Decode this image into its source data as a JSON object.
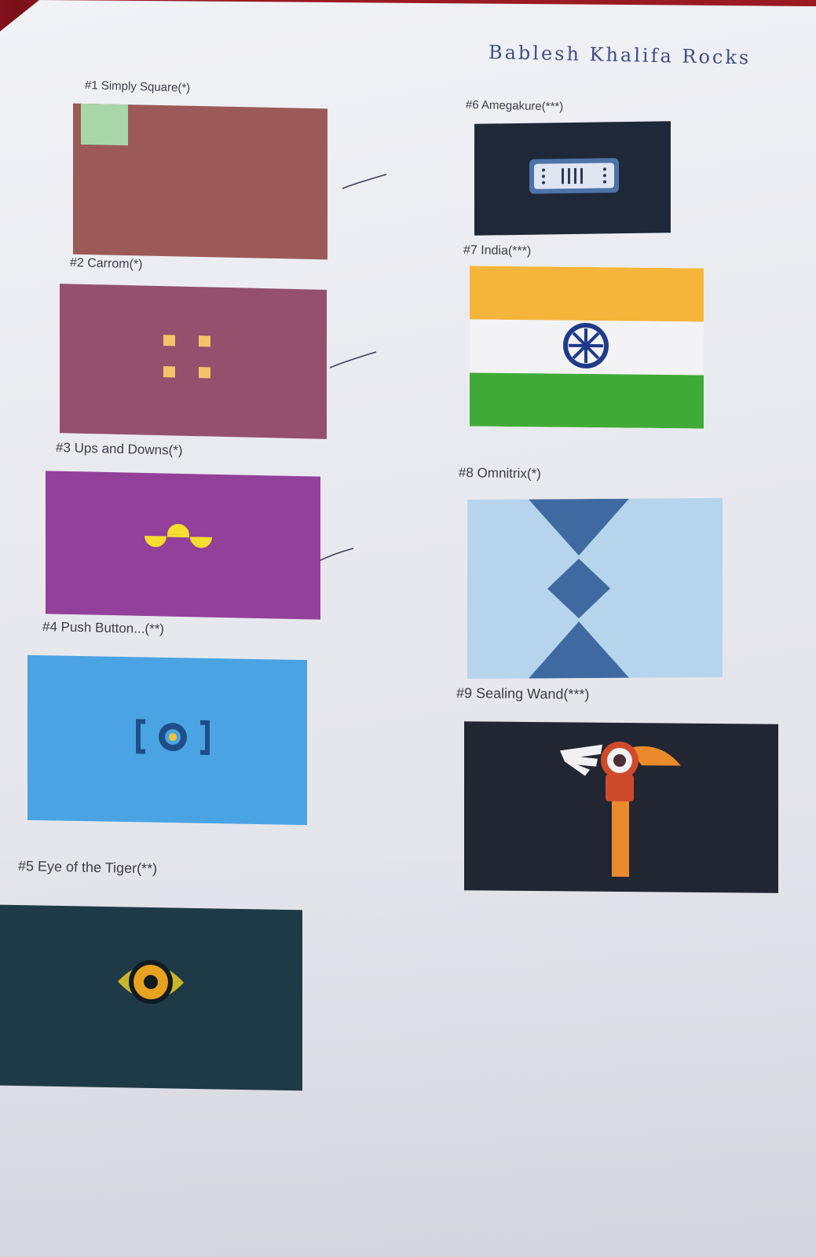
{
  "note": {
    "handwritten_header": "Bablesh Khalifa Rocks"
  },
  "flags": [
    {
      "label": "#1 Simply Square(*)"
    },
    {
      "label": "#2 Carrom(*)"
    },
    {
      "label": "#3 Ups and Downs(*)"
    },
    {
      "label": "#4 Push Button...(**)"
    },
    {
      "label": "#5 Eye of the Tiger(**)"
    },
    {
      "label": "#6 Amegakure(***)"
    },
    {
      "label": "#7 India(***)"
    },
    {
      "label": "#8 Omnitrix(*)"
    },
    {
      "label": "#9 Sealing Wand(***)"
    }
  ],
  "colors": {
    "simply_square_field": "#9b5a58",
    "simply_square_corner": "#a9d6a9",
    "carrom_field": "#94506c",
    "carrom_dots": "#f4c46a",
    "ups_downs_field": "#93409b",
    "ups_downs_shapes": "#f5de2e",
    "push_button_field": "#4aa3e3",
    "eye_tiger_field": "#1f3a47",
    "amegakure_field": "#1f2838",
    "india_saffron": "#f5b53b",
    "india_green": "#3fab36",
    "india_chakra": "#1e3a8a",
    "omnitrix_field": "#b6d5ec",
    "omnitrix_shapes": "#3f6aa1",
    "sealing_wand_field": "#222633"
  }
}
